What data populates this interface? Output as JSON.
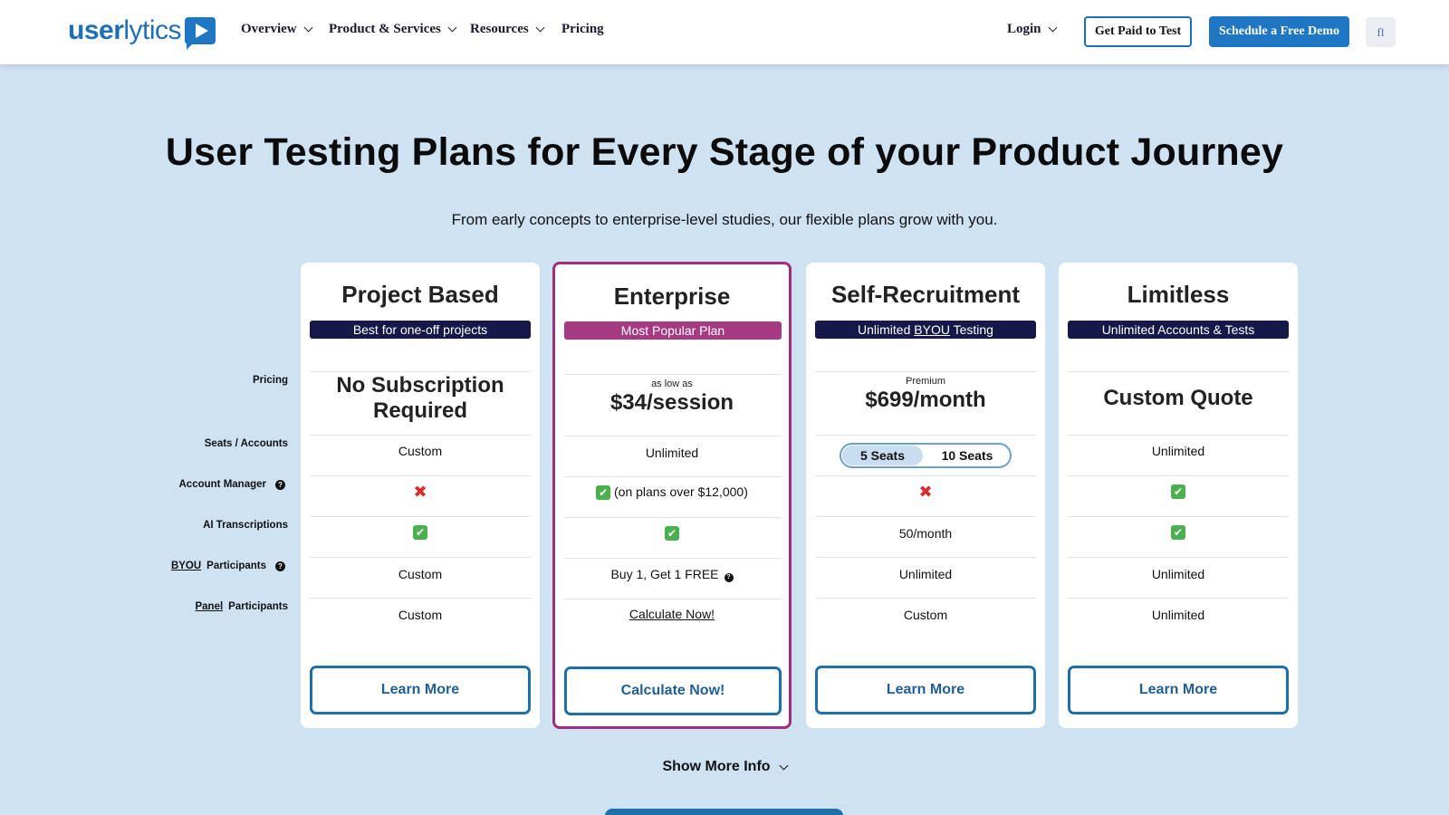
{
  "header": {
    "logo": {
      "part1": "user",
      "part2": "lytics"
    },
    "nav": [
      {
        "label": "Overview",
        "has_dropdown": true
      },
      {
        "label": "Product & Services",
        "has_dropdown": true
      },
      {
        "label": "Resources",
        "has_dropdown": true
      },
      {
        "label": "Pricing",
        "has_dropdown": false
      }
    ],
    "login": "Login",
    "get_paid": "Get Paid to Test",
    "demo": "Schedule a Free Demo",
    "search_glyph": "fl"
  },
  "hero": {
    "title": "User Testing Plans for Every Stage of your Product Journey",
    "subtitle": "From early concepts to enterprise-level studies, our flexible plans grow with you."
  },
  "row_labels": {
    "pricing": "Pricing",
    "seats": "Seats / Accounts",
    "account_manager": "Account Manager",
    "ai": "AI Transcriptions",
    "byou_link": "BYOU",
    "byou_rest": "Participants",
    "panel_link": "Panel",
    "panel_rest": "Participants",
    "help_glyph": "?"
  },
  "plans": [
    {
      "title": "Project Based",
      "badge": "Best for one-off projects",
      "price_line1": "No Subscription",
      "price_line2": "Required",
      "seats": "Custom",
      "account_manager": "✖",
      "ai": "✔",
      "byou": "Custom",
      "panel": "Custom",
      "button": "Learn More"
    },
    {
      "title": "Enterprise",
      "badge": "Most Popular Plan",
      "price_prefix": "as low as",
      "price": "$34/session",
      "seats": "Unlimited",
      "account_manager_check": "✔",
      "account_manager_text": "(on plans over $12,000)",
      "ai": "✔",
      "byou": "Buy 1, Get 1 FREE",
      "panel": "Calculate Now!",
      "button": "Calculate Now!"
    },
    {
      "title": "Self-Recruitment",
      "badge_pre": "Unlimited",
      "badge_link": "BYOU",
      "badge_post": "Testing",
      "price_prefix": "Premium",
      "price": "$699/month",
      "seat_options": [
        "5 Seats",
        "10 Seats"
      ],
      "seat_selected": "5 Seats",
      "account_manager": "✖",
      "ai": "50/month",
      "byou": "Unlimited",
      "panel": "Custom",
      "button": "Learn More"
    },
    {
      "title": "Limitless",
      "badge": "Unlimited Accounts & Tests",
      "price": "Custom Quote",
      "seats": "Unlimited",
      "account_manager": "✔",
      "ai": "✔",
      "byou": "Unlimited",
      "panel": "Unlimited",
      "button": "Learn More"
    }
  ],
  "show_more": "Show More Info",
  "colors": {
    "page_bg": "#cfe2f2",
    "brand_blue": "#1f77c4",
    "badge_navy": "#16184a",
    "featured_magenta": "#9e2f7e"
  }
}
